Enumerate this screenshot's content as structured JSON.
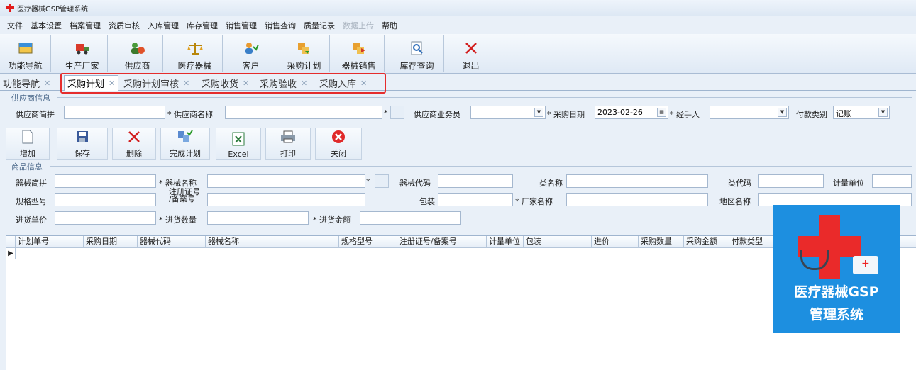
{
  "window": {
    "title": "医疗器械GSP管理系统"
  },
  "menu": [
    "文件",
    "基本设置",
    "档案管理",
    "资质审核",
    "入库管理",
    "库存管理",
    "销售管理",
    "销售查询",
    "质量记录",
    "数据上传",
    "帮助"
  ],
  "toolbar": [
    {
      "label": "功能导航",
      "icon": "navigation-icon"
    },
    {
      "label": "生产厂家",
      "icon": "manufacturer-truck-icon"
    },
    {
      "label": "供应商",
      "icon": "supplier-icon"
    },
    {
      "label": "医疗器械",
      "icon": "balance-scale-icon"
    },
    {
      "label": "客户",
      "icon": "customer-icon"
    },
    {
      "label": "采购计划",
      "icon": "purchase-plan-icon"
    },
    {
      "label": "器械销售",
      "icon": "sales-icon"
    },
    {
      "label": "库存查询",
      "icon": "inventory-search-icon"
    },
    {
      "label": "退出",
      "icon": "exit-icon"
    }
  ],
  "tabs": [
    {
      "label": "功能导航",
      "active": false
    },
    {
      "label": "采购计划",
      "active": true
    },
    {
      "label": "采购计划审核",
      "active": false
    },
    {
      "label": "采购收货",
      "active": false
    },
    {
      "label": "采购验收",
      "active": false
    },
    {
      "label": "采购入库",
      "active": false
    }
  ],
  "supplier_group": {
    "title": "供应商信息",
    "code_label": "供应商简拼",
    "name_label": "* 供应商名称",
    "salesman_label": "供应商业务员",
    "date_label": "* 采购日期",
    "date_value": "2023-02-26",
    "handler_label": "* 经手人",
    "payment_label": "付款类别",
    "payment_value": "记账",
    "star": "*"
  },
  "actions": [
    "增加",
    "保存",
    "删除",
    "完成计划",
    "Excel",
    "打印",
    "关闭"
  ],
  "product_group": {
    "title": "商品信息",
    "code_label": "器械简拼",
    "name_label": "* 器械名称",
    "device_code_label": "器械代码",
    "category_label": "类名称",
    "class_code_label": "类代码",
    "unit_label": "计量单位",
    "spec_label": "规格型号",
    "reg_label_1": "注册证号",
    "reg_label_2": "/备案号",
    "pack_label": "包装",
    "maker_label": "* 厂家名称",
    "region_label": "地区名称",
    "price_label": "进货单价",
    "qty_label": "* 进货数量",
    "amount_label": "* 进货金额",
    "star": "*"
  },
  "grid": {
    "columns": [
      "计划单号",
      "采购日期",
      "器械代码",
      "器械名称",
      "规格型号",
      "注册证号/备案号",
      "计量单位",
      "包装",
      "进价",
      "采购数量",
      "采购金额",
      "付款类型"
    ],
    "row_marker": "▶"
  },
  "promo": {
    "line1": "医疗器械GSP",
    "line2": "管理系统"
  },
  "colors": {
    "accent": "#1d8fe0",
    "highlight": "#e52d2d",
    "cross": "#e21b1b"
  }
}
